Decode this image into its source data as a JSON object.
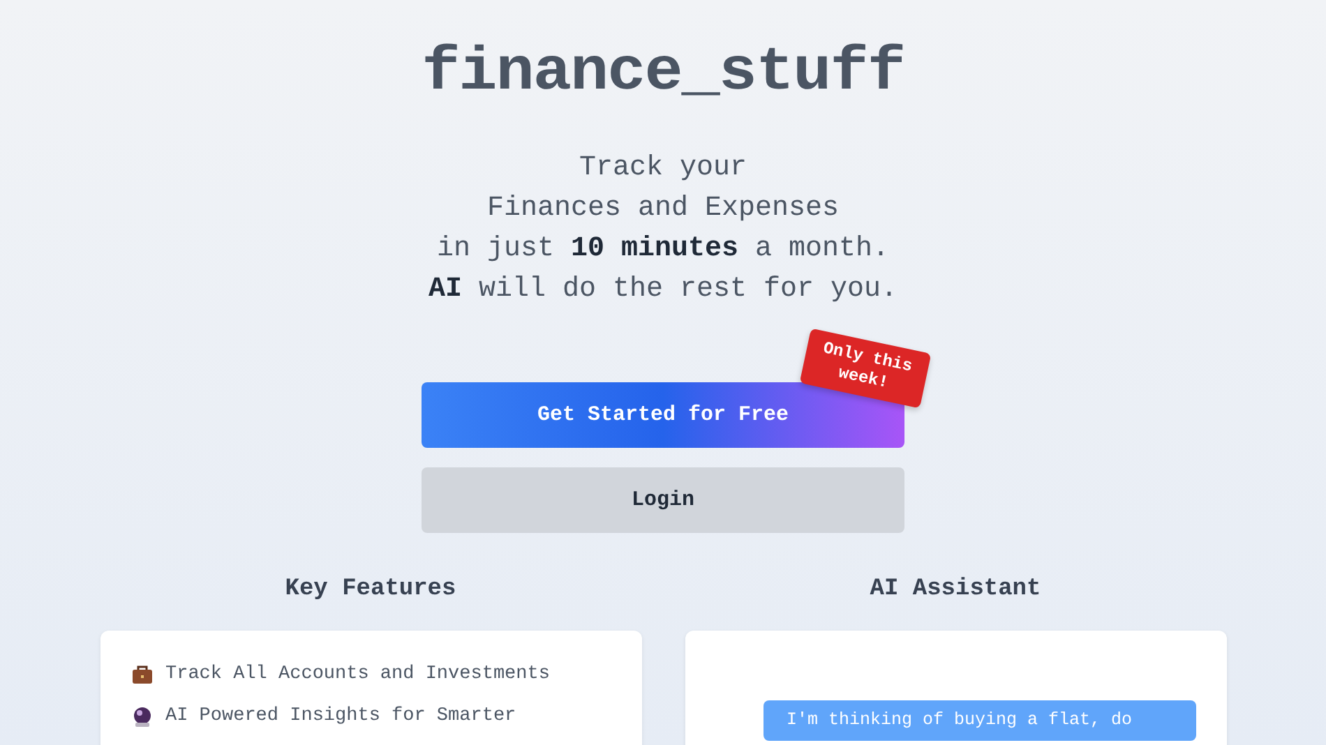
{
  "logo": "finance_stuff",
  "tagline": [
    "Track your",
    "Finances and Expenses",
    "in just **10 minutes** a month.",
    "**AI** will do the rest for you."
  ],
  "primary_button": "Get Started for Free",
  "promo_badge": "Only this week!",
  "secondary_button": "Login",
  "features": {
    "title": "Key Features",
    "items": [
      {
        "kind": "briefcase",
        "label": "Track All Accounts and Investments"
      },
      {
        "kind": "ball",
        "label": "AI Powered Insights for Smarter"
      }
    ]
  },
  "assistant": {
    "title": "AI Assistant",
    "messages": [
      {
        "kind": "outgoing",
        "text": "I'm thinking of buying a flat, do"
      }
    ]
  }
}
